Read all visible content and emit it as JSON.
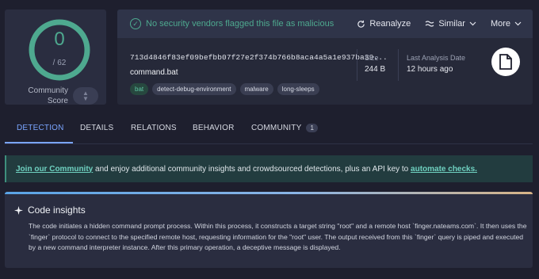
{
  "score": {
    "detections": "0",
    "total": "/ 62",
    "community_label_1": "Community",
    "community_label_2": "Score"
  },
  "status": {
    "message": "No security vendors flagged this file as malicious",
    "color": "#4ea98f"
  },
  "actions": {
    "reanalyze": "Reanalyze",
    "similar": "Similar",
    "more": "More"
  },
  "file": {
    "hash": "713d4846f83ef09befbb07f27e2f374b766b8aca4a5a1e937ba39...",
    "name": "command.bat",
    "tags": [
      "bat",
      "detect-debug-environment",
      "malware",
      "long-sleeps"
    ],
    "size_label": "Size",
    "size_value": "244 B",
    "last_analysis_label": "Last Analysis Date",
    "last_analysis_value": "12 hours ago"
  },
  "tabs": [
    {
      "label": "DETECTION"
    },
    {
      "label": "DETAILS"
    },
    {
      "label": "RELATIONS"
    },
    {
      "label": "BEHAVIOR"
    },
    {
      "label": "COMMUNITY",
      "badge": "1"
    }
  ],
  "banner": {
    "join_link": "Join our Community",
    "text": " and enjoy additional community insights and crowdsourced detections, plus an API key to ",
    "automate_link": "automate checks."
  },
  "insights": {
    "title": "Code insights",
    "body": "The code initiates a hidden command prompt process. Within this process, it constructs a target string \"root\" and a remote host `finger.nateams.com`. It then uses the `finger` protocol to connect to the specified remote host, requesting information for the \"root\" user. The output received from this `finger` query is piped and executed by a new command interpreter instance. After this primary operation, a deceptive message is displayed."
  },
  "colors": {
    "accent": "#7aa5ff",
    "safe": "#4ea98f",
    "background": "#1e1f2e"
  }
}
